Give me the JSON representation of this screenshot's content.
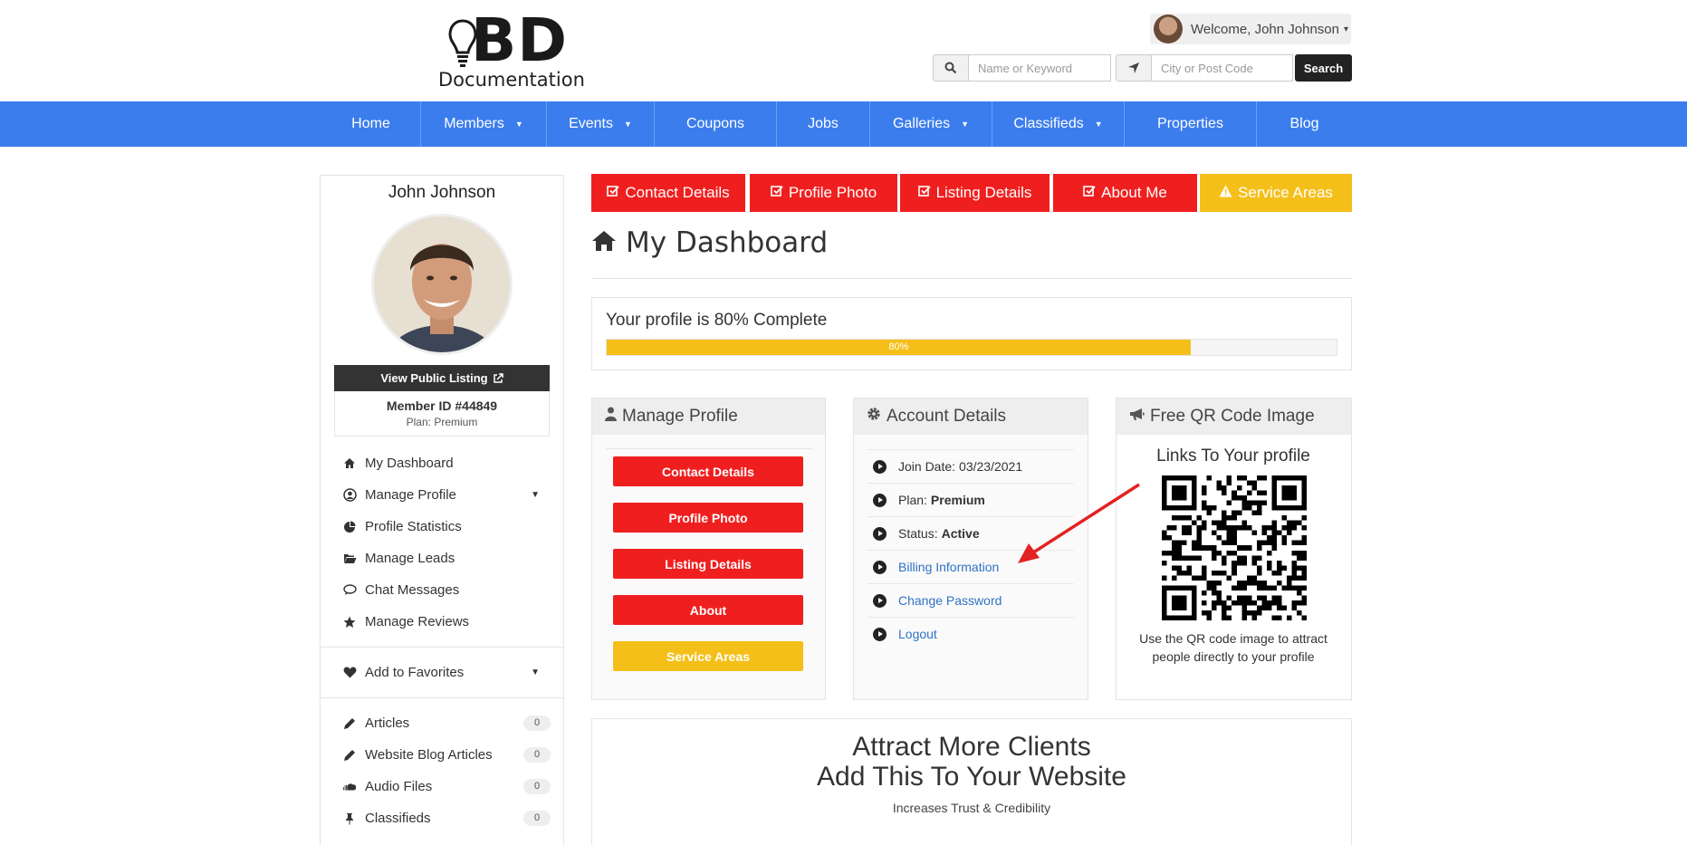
{
  "site": {
    "logo_main": "BD",
    "logo_sub": "Documentation"
  },
  "header": {
    "welcome": "Welcome, John Johnson",
    "keyword_placeholder": "Name or Keyword",
    "location_placeholder": "City or Post Code",
    "search_label": "Search"
  },
  "nav": [
    {
      "label": "Home",
      "dropdown": false
    },
    {
      "label": "Members",
      "dropdown": true
    },
    {
      "label": "Events",
      "dropdown": true
    },
    {
      "label": "Coupons",
      "dropdown": false
    },
    {
      "label": "Jobs",
      "dropdown": false
    },
    {
      "label": "Galleries",
      "dropdown": true
    },
    {
      "label": "Classifieds",
      "dropdown": true
    },
    {
      "label": "Properties",
      "dropdown": false
    },
    {
      "label": "Blog",
      "dropdown": false
    }
  ],
  "sidebar": {
    "name": "John Johnson",
    "view_listing": "View Public Listing",
    "member_id": "Member ID #44849",
    "plan": "Plan: Premium",
    "menu": [
      {
        "label": "My Dashboard",
        "icon": "home-icon"
      },
      {
        "label": "Manage Profile",
        "icon": "user-circle-icon"
      },
      {
        "label": "Profile Statistics",
        "icon": "pie-chart-icon"
      },
      {
        "label": "Manage Leads",
        "icon": "folder-open-icon"
      },
      {
        "label": "Chat Messages",
        "icon": "chat-icon"
      },
      {
        "label": "Manage Reviews",
        "icon": "star-icon"
      }
    ],
    "favorites": "Add to Favorites",
    "content": [
      {
        "label": "Articles",
        "count": "0",
        "icon": "pencil-icon"
      },
      {
        "label": "Website Blog Articles",
        "count": "0",
        "icon": "pencil-icon"
      },
      {
        "label": "Audio Files",
        "count": "0",
        "icon": "soundcloud-icon"
      },
      {
        "label": "Classifieds",
        "count": "0",
        "icon": "thumbtack-icon"
      }
    ]
  },
  "tabs": [
    {
      "label": "Contact Details",
      "color": "#f01f1f"
    },
    {
      "label": "Profile Photo",
      "color": "#f01f1f"
    },
    {
      "label": "Listing Details",
      "color": "#f01f1f"
    },
    {
      "label": "About Me",
      "color": "#f01f1f"
    },
    {
      "label": "Service Areas",
      "color": "#f5bf1a"
    }
  ],
  "dashboard": {
    "title": "My Dashboard",
    "progress_text": "Your profile is 80% Complete",
    "progress_value": 80,
    "progress_label": "80%"
  },
  "manage_profile": {
    "title": "Manage Profile",
    "buttons": [
      {
        "label": "Contact Details",
        "color": "#f01f1f"
      },
      {
        "label": "Profile Photo",
        "color": "#f01f1f"
      },
      {
        "label": "Listing Details",
        "color": "#f01f1f"
      },
      {
        "label": "About",
        "color": "#f01f1f"
      },
      {
        "label": "Service Areas",
        "color": "#f5bf1a"
      }
    ]
  },
  "account": {
    "title": "Account Details",
    "join_label": "Join Date:",
    "join_value": "03/23/2021",
    "plan_label": "Plan:",
    "plan_value": "Premium",
    "status_label": "Status:",
    "status_value": "Active",
    "billing": "Billing Information",
    "password": "Change Password",
    "logout": "Logout"
  },
  "qr": {
    "title": "Free QR Code Image",
    "subtitle": "Links To Your profile",
    "caption": "Use the QR code image to attract people directly to your profile"
  },
  "attract": {
    "line1": "Attract More Clients",
    "line2": "Add This To Your Website",
    "line3": "Increases Trust & Credibility"
  },
  "colors": {
    "nav": "#3b7ded",
    "red": "#f01f1f",
    "yellow": "#f5bf1a",
    "link": "#2f72c4"
  }
}
